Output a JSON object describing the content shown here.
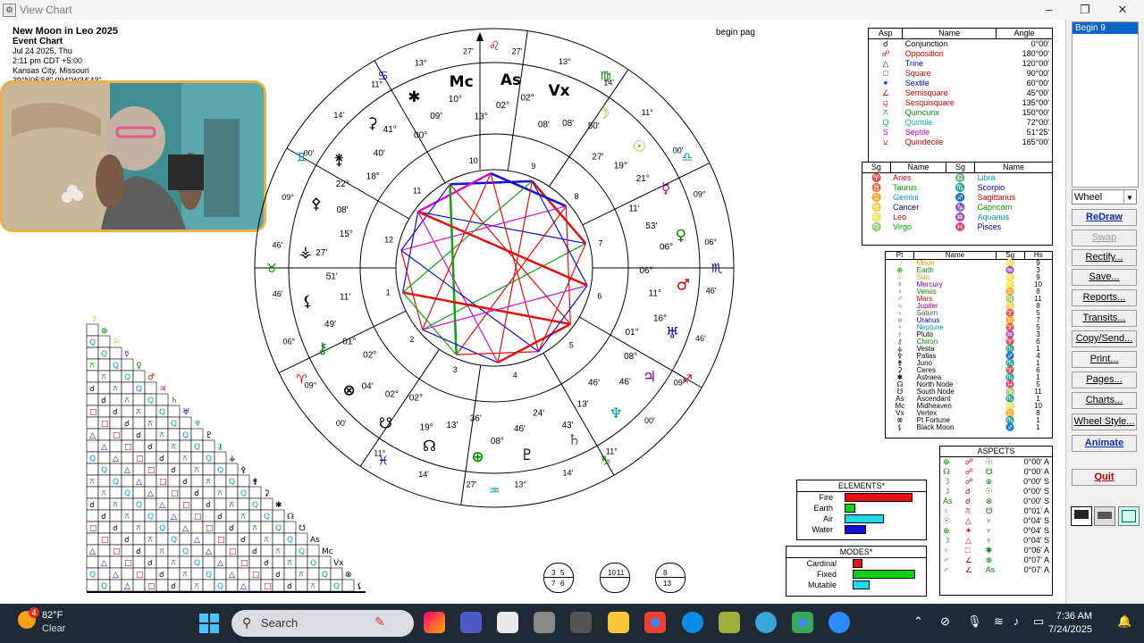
{
  "window": {
    "title": "View Chart",
    "min": "–",
    "max": "❐",
    "close": "✕"
  },
  "chart_header": {
    "title": "New Moon in Leo 2025",
    "subtitle": "Event Chart",
    "date": "Jul 24 2025, Thu",
    "time": "2:11 pm  CDT +5:00",
    "place": "Kansas City, Missouri",
    "coords": "39°N05'58\" 094°W34'43\""
  },
  "begin_page": "begin pag",
  "aspect_legend": {
    "headers": [
      "Asp",
      "Name",
      "Angle"
    ],
    "rows": [
      {
        "sym": "☌",
        "name": "Conjunction",
        "angle": "0°00'",
        "color": "#000000"
      },
      {
        "sym": "☍",
        "name": "Opposition",
        "angle": "180°00'",
        "color": "#d00000"
      },
      {
        "sym": "△",
        "name": "Trine",
        "angle": "120°00'",
        "color": "#0000cc"
      },
      {
        "sym": "□",
        "name": "Square",
        "angle": "90°00'",
        "color": "#d00000"
      },
      {
        "sym": "✶",
        "name": "Sextile",
        "angle": "60°00'",
        "color": "#0000cc"
      },
      {
        "sym": "∠",
        "name": "Semisquare",
        "angle": "45°00'",
        "color": "#d00000"
      },
      {
        "sym": "⚼",
        "name": "Sesquisquare",
        "angle": "135°00'",
        "color": "#d00000"
      },
      {
        "sym": "⚻",
        "name": "Quincunx",
        "angle": "150°00'",
        "color": "#008800"
      },
      {
        "sym": "Q",
        "name": "Quintile",
        "angle": "72°00'",
        "color": "#00b0c0"
      },
      {
        "sym": "S",
        "name": "Septile",
        "angle": "51°25'",
        "color": "#d000d0"
      },
      {
        "sym": "⚺",
        "name": "Quindecile",
        "angle": "165°00'",
        "color": "#d00000"
      }
    ]
  },
  "sign_legend": {
    "headers": [
      "Sg",
      "Name",
      "Sg",
      "Name"
    ],
    "rows": [
      [
        {
          "sym": "♈",
          "name": "Aries",
          "color": "#d00000"
        },
        {
          "sym": "♎",
          "name": "Libra",
          "color": "#00a0c0"
        }
      ],
      [
        {
          "sym": "♉",
          "name": "Taurus",
          "color": "#00a000"
        },
        {
          "sym": "♏",
          "name": "Scorpio",
          "color": "#0000aa"
        }
      ],
      [
        {
          "sym": "♊",
          "name": "Gemini",
          "color": "#00a0c0"
        },
        {
          "sym": "♐",
          "name": "Sagittarius",
          "color": "#d00000"
        }
      ],
      [
        {
          "sym": "♋",
          "name": "Cancer",
          "color": "#0000aa"
        },
        {
          "sym": "♑",
          "name": "Capricorn",
          "color": "#00a000"
        }
      ],
      [
        {
          "sym": "♌",
          "name": "Leo",
          "color": "#d00000"
        },
        {
          "sym": "♒",
          "name": "Aquarius",
          "color": "#00a0c0"
        }
      ],
      [
        {
          "sym": "♍",
          "name": "Virgo",
          "color": "#00a000"
        },
        {
          "sym": "♓",
          "name": "Pisces",
          "color": "#0000aa"
        }
      ]
    ]
  },
  "planet_legend": {
    "headers": [
      "Pt",
      "Name",
      "Sg",
      "Hs"
    ],
    "rows": [
      {
        "sym": "☽",
        "name": "Moon",
        "sg": "♌",
        "hs": "9",
        "color": "#c8a000"
      },
      {
        "sym": "⊕",
        "name": "Earth",
        "sg": "♒",
        "hs": "3",
        "color": "#008800"
      },
      {
        "sym": "☉",
        "name": "Sun",
        "sg": "♌",
        "hs": "9",
        "color": "#c8a000"
      },
      {
        "sym": "☿",
        "name": "Mercury",
        "sg": "♌",
        "hs": "10",
        "color": "#880088"
      },
      {
        "sym": "♀",
        "name": "Venus",
        "sg": "♊",
        "hs": "8",
        "color": "#008800"
      },
      {
        "sym": "♂",
        "name": "Mars",
        "sg": "♍",
        "hs": "11",
        "color": "#d00000"
      },
      {
        "sym": "♃",
        "name": "Jupiter",
        "sg": "♋",
        "hs": "8",
        "color": "#880088"
      },
      {
        "sym": "♄",
        "name": "Saturn",
        "sg": "♈",
        "hs": "5",
        "color": "#555555"
      },
      {
        "sym": "♅",
        "name": "Uranus",
        "sg": "♊",
        "hs": "7",
        "color": "#0000cc"
      },
      {
        "sym": "♆",
        "name": "Neptune",
        "sg": "♈",
        "hs": "5",
        "color": "#00a0a0"
      },
      {
        "sym": "♇",
        "name": "Pluto",
        "sg": "♒",
        "hs": "3",
        "color": "#000000"
      },
      {
        "sym": "⚷",
        "name": "Chiron",
        "sg": "♈",
        "hs": "6",
        "color": "#008800"
      },
      {
        "sym": "⚶",
        "name": "Vesta",
        "sg": "♏",
        "hs": "1",
        "color": "#000000"
      },
      {
        "sym": "⚴",
        "name": "Pallas",
        "sg": "♐",
        "hs": "4",
        "color": "#000000"
      },
      {
        "sym": "⚵",
        "name": "Juno",
        "sg": "♏",
        "hs": "1",
        "color": "#000000"
      },
      {
        "sym": "⚳",
        "name": "Ceres",
        "sg": "♈",
        "hs": "6",
        "color": "#000000"
      },
      {
        "sym": "✱",
        "name": "Astraea",
        "sg": "♏",
        "hs": "1",
        "color": "#000000"
      },
      {
        "sym": "☊",
        "name": "North Node",
        "sg": "♓",
        "hs": "5",
        "color": "#000000"
      },
      {
        "sym": "☋",
        "name": "South Node",
        "sg": "♍",
        "hs": "11",
        "color": "#000000"
      },
      {
        "sym": "As",
        "name": "Ascendant",
        "sg": "♏",
        "hs": "1",
        "color": "#000000"
      },
      {
        "sym": "Mc",
        "name": "Midheaven",
        "sg": "♌",
        "hs": "10",
        "color": "#000000"
      },
      {
        "sym": "Vx",
        "name": "Vertex",
        "sg": "♊",
        "hs": "8",
        "color": "#000000"
      },
      {
        "sym": "⊗",
        "name": "Pt Fortune",
        "sg": "♏",
        "hs": "1",
        "color": "#000000"
      },
      {
        "sym": "⚸",
        "name": "Black Moon",
        "sg": "♐",
        "hs": "1",
        "color": "#000000"
      }
    ]
  },
  "aspects_panel": {
    "title": "ASPECTS",
    "rows": [
      {
        "p1": "⊕",
        "asp": "☍",
        "p2": "☉",
        "orb": "0°00' A"
      },
      {
        "p1": "☊",
        "asp": "☍",
        "p2": "☋",
        "orb": "0°00' A"
      },
      {
        "p1": "☽",
        "asp": "☍",
        "p2": "⊕",
        "orb": "0°00' S"
      },
      {
        "p1": "☽",
        "asp": "☌",
        "p2": "☉",
        "orb": "0°00' S"
      },
      {
        "p1": "As",
        "asp": "☌",
        "p2": "⊗",
        "orb": "0°00' S"
      },
      {
        "p1": "♀",
        "asp": "⚻",
        "p2": "☋",
        "orb": "0°01' A"
      },
      {
        "p1": "☉",
        "asp": "△",
        "p2": "♆",
        "orb": "0°04' S"
      },
      {
        "p1": "⊕",
        "asp": "✶",
        "p2": "♆",
        "orb": "0°04' S"
      },
      {
        "p1": "☽",
        "asp": "△",
        "p2": "♆",
        "orb": "0°04' S"
      },
      {
        "p1": "♀",
        "asp": "□",
        "p2": "✱",
        "orb": "0°06' A"
      },
      {
        "p1": "♂",
        "asp": "∠",
        "p2": "⊗",
        "orb": "0°07' A"
      },
      {
        "p1": "♂",
        "asp": "∠",
        "p2": "As",
        "orb": "0°07' A"
      }
    ]
  },
  "elements_panel": {
    "title": "ELEMENTS*",
    "rows": [
      {
        "label": "Fire",
        "value": 0.95,
        "color": "#e81010"
      },
      {
        "label": "Earth",
        "value": 0.15,
        "color": "#10d010"
      },
      {
        "label": "Air",
        "value": 0.55,
        "color": "#20d8e8"
      },
      {
        "label": "Water",
        "value": 0.3,
        "color": "#1010d8"
      }
    ]
  },
  "modes_panel": {
    "title": "MODES*",
    "rows": [
      {
        "label": "Cardinal",
        "value": 0.15,
        "color": "#e81010"
      },
      {
        "label": "Fixed",
        "value": 0.95,
        "color": "#10d010"
      },
      {
        "label": "Mutable",
        "value": 0.25,
        "color": "#20d8e8"
      }
    ]
  },
  "house_icons": [
    {
      "a": "3",
      "b": "5",
      "c": "7",
      "d": "6"
    },
    {
      "a": "10",
      "b": "11",
      "c": "",
      "d": ""
    },
    {
      "a": "8",
      "b": "",
      "c": "13",
      "d": ""
    }
  ],
  "wheel": {
    "houses": [
      "1",
      "2",
      "3",
      "4",
      "5",
      "6",
      "7",
      "8",
      "9",
      "10",
      "11",
      "12"
    ],
    "sign_glyphs": [
      "♌",
      "♍",
      "♎",
      "♏",
      "♐",
      "♑",
      "♒",
      "♓",
      "♈",
      "♉",
      "♊",
      "♋"
    ],
    "outer_degrees": [
      "27'",
      "13°",
      "14'",
      "11°",
      "00'",
      "09°",
      "06°",
      "46'",
      "46'",
      "09°",
      "00'",
      "11°",
      "14'",
      "13°",
      "27'",
      "14'",
      "11°",
      "00'",
      "09°",
      "06°",
      "46'",
      "46'",
      "09°",
      "00'",
      "14'",
      "11°",
      "13°",
      "27'"
    ],
    "planet_labels": [
      "Mc",
      "As",
      "Vx",
      "☽",
      "☉",
      "☿",
      "♀",
      "♂",
      "♅",
      "♃",
      "♆",
      "♄",
      "♇",
      "⊕",
      "☊",
      "☋",
      "⊗",
      "⚷",
      "⚸",
      "⚶",
      "⚴",
      "⚵",
      "⚳",
      "✱"
    ],
    "degree_labels": [
      "13°",
      "02°",
      "02°",
      "08'",
      "08'",
      "50'",
      "27'",
      "19°",
      "21°",
      "11'",
      "53'",
      "06°",
      "06°",
      "11°",
      "16°",
      "01°",
      "08°",
      "46'",
      "46'",
      "13'",
      "43'",
      "24'",
      "46'",
      "08°",
      "36'",
      "13'",
      "19°",
      "02°",
      "02°",
      "04'",
      "02°",
      "01°",
      "49'",
      "11'",
      "51'",
      "27'",
      "15°",
      "08'",
      "22°",
      "18°",
      "40'",
      "41°",
      "00°",
      "09'",
      "10°"
    ]
  },
  "sidebar": {
    "list_selected": "Begin 9",
    "combo_value": "Wheel",
    "buttons": [
      "ReDraw",
      "Swap",
      "Rectify...",
      "Save...",
      "Reports...",
      "Transits...",
      "Copy/Send...",
      "Print...",
      "Pages...",
      "Charts...",
      "Wheel Style...",
      "Animate",
      "Quit"
    ]
  },
  "taskbar": {
    "weather_badge": "4",
    "weather_temp": "82°F",
    "weather_desc": "Clear",
    "search_label": "Search",
    "time": "7:36 AM",
    "date": "7/24/2025"
  }
}
